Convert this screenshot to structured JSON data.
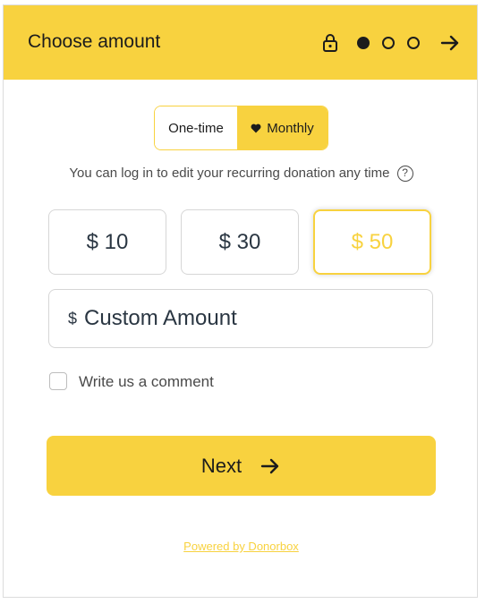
{
  "header": {
    "title": "Choose amount",
    "steps": 3,
    "active_step": 1
  },
  "frequency": {
    "one_time_label": "One-time",
    "monthly_label": "Monthly",
    "selected": "Monthly"
  },
  "note": {
    "text": "You can log in to edit your recurring donation any time",
    "help_glyph": "?"
  },
  "amounts": [
    {
      "label": "$ 10"
    },
    {
      "label": "$ 30"
    },
    {
      "label": "$ 50",
      "selected": true
    }
  ],
  "custom": {
    "currency": "$",
    "placeholder": "Custom Amount"
  },
  "comment": {
    "label": "Write us a comment",
    "checked": false
  },
  "next": {
    "label": "Next"
  },
  "footer": {
    "powered_by": "Powered by Donorbox"
  },
  "colors": {
    "accent": "#f8d23f",
    "text": "#1c1c1c",
    "muted": "#4a4a4a",
    "border": "#d6d6d6"
  }
}
